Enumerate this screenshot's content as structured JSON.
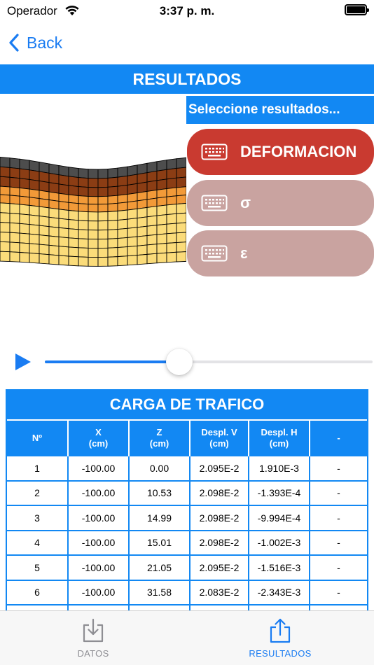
{
  "status_bar": {
    "carrier": "Operador",
    "time": "3:37 p. m."
  },
  "nav": {
    "back_label": "Back"
  },
  "header": {
    "title": "RESULTADOS"
  },
  "selector": {
    "label": "Seleccione resultados...",
    "options": [
      {
        "label": "DEFORMACION",
        "selected": true,
        "color": "#c93a30"
      },
      {
        "label": "σ",
        "selected": false,
        "color": "#c9a3a0"
      },
      {
        "label": "ε",
        "selected": false,
        "color": "#c9a3a0"
      }
    ]
  },
  "player": {
    "progress_fraction": 0.41
  },
  "table": {
    "title": "CARGA DE TRAFICO",
    "columns": [
      {
        "line1": "Nº",
        "line2": ""
      },
      {
        "line1": "X",
        "line2": "(cm)"
      },
      {
        "line1": "Z",
        "line2": "(cm)"
      },
      {
        "line1": "Despl. V",
        "line2": "(cm)"
      },
      {
        "line1": "Despl. H",
        "line2": "(cm)"
      },
      {
        "line1": "-",
        "line2": ""
      }
    ],
    "rows": [
      [
        "1",
        "-100.00",
        "0.00",
        "2.095E-2",
        "1.910E-3",
        "-"
      ],
      [
        "2",
        "-100.00",
        "10.53",
        "2.098E-2",
        "-1.393E-4",
        "-"
      ],
      [
        "3",
        "-100.00",
        "14.99",
        "2.098E-2",
        "-9.994E-4",
        "-"
      ],
      [
        "4",
        "-100.00",
        "15.01",
        "2.098E-2",
        "-1.002E-3",
        "-"
      ],
      [
        "5",
        "-100.00",
        "21.05",
        "2.095E-2",
        "-1.516E-3",
        "-"
      ],
      [
        "6",
        "-100.00",
        "31.58",
        "2.083E-2",
        "-2.343E-3",
        "-"
      ]
    ]
  },
  "tabs": [
    {
      "label": "DATOS",
      "active": false,
      "icon": "download-tray-icon"
    },
    {
      "label": "RESULTADOS",
      "active": true,
      "icon": "share-icon"
    }
  ],
  "colors": {
    "accent": "#1288f3",
    "link": "#1a7cf2",
    "layer_dark": "#4d4d4d",
    "layer_brown": "#8b3d14",
    "layer_orange": "#f29a38",
    "layer_yellow": "#fbdc7a"
  }
}
